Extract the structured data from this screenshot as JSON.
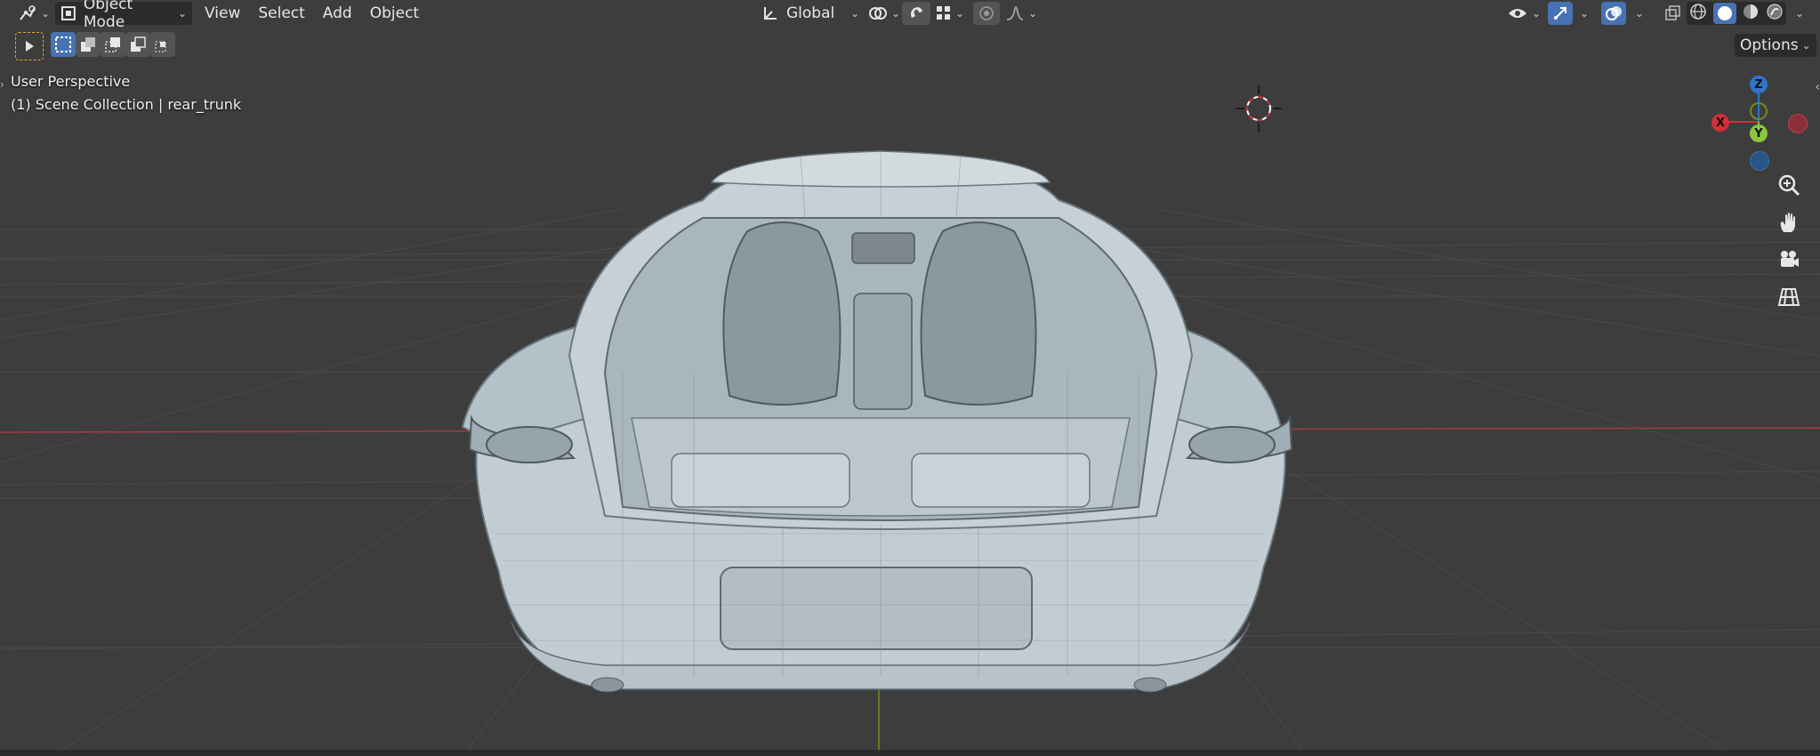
{
  "header": {
    "mode_label": "Object Mode",
    "menus": [
      "View",
      "Select",
      "Add",
      "Object"
    ],
    "transform_orientation": "Global",
    "options_label": "Options"
  },
  "viewport": {
    "perspective_label": "User Perspective",
    "collection_label": "(1) Scene Collection | rear_trunk"
  },
  "gizmo": {
    "axes": {
      "z": "Z",
      "x": "X",
      "y": "Y"
    }
  },
  "colors": {
    "background": "#3d3d3d",
    "grid": "#484848",
    "x_axis": "#a33a44",
    "y_axis": "#6b8e23",
    "z_axis": "#2f75c9",
    "accent": "#4772b3",
    "model": "#c2cdd3"
  },
  "icons": {
    "editor_type": "editor-type-icon",
    "mode": "object-mode-icon",
    "orientation": "transform-orientation-icon",
    "pivot": "pivot-point-icon",
    "snap": "snap-icon",
    "snap_target": "snap-increment-icon",
    "proportional": "proportional-editing-icon",
    "falloff": "falloff-curve-icon",
    "visibility": "eye-icon",
    "gizmo": "gizmo-icon",
    "overlays": "overlays-icon",
    "xray": "xray-icon",
    "wireframe": "wireframe-shading-icon",
    "solid": "solid-shading-icon",
    "material": "material-preview-icon",
    "rendered": "rendered-shading-icon",
    "zoom": "zoom-icon",
    "pan": "hand-icon",
    "camera": "camera-icon",
    "ortho": "grid-projection-icon"
  }
}
